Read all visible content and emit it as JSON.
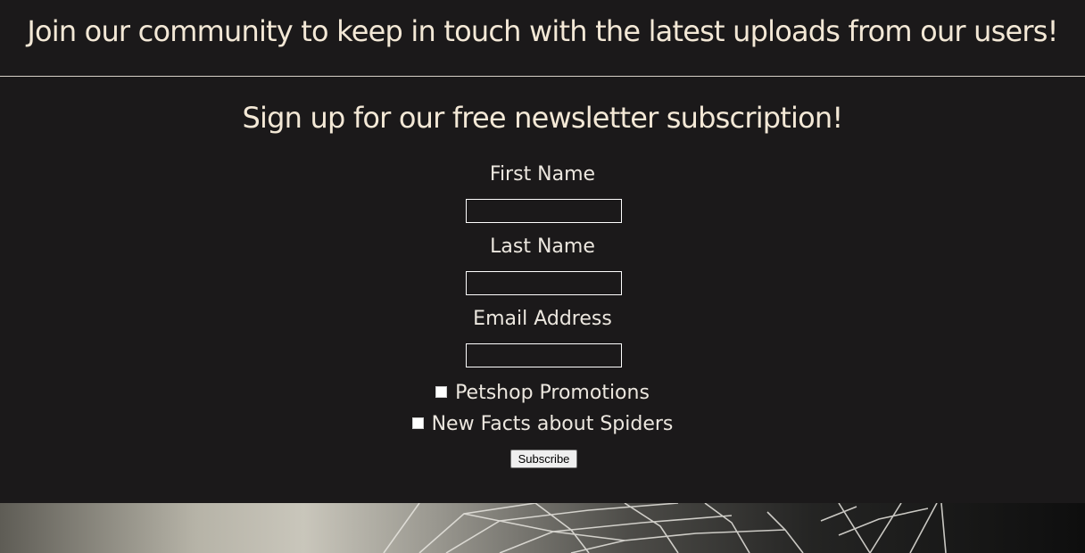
{
  "banner": {
    "heading": "Join our community to keep in touch with the latest uploads from our users!"
  },
  "newsletter": {
    "heading": "Sign up for our free newsletter subscription!",
    "fields": [
      {
        "label": "First Name",
        "value": ""
      },
      {
        "label": "Last Name",
        "value": ""
      },
      {
        "label": "Email Address",
        "value": ""
      }
    ],
    "checkboxes": [
      {
        "label": "Petshop Promotions",
        "checked": false
      },
      {
        "label": "New Facts about Spiders",
        "checked": false
      }
    ],
    "submit_label": "Subscribe"
  },
  "hero": {
    "image": "spider-web-photo"
  },
  "colors": {
    "background": "#1b191a",
    "heading_text": "#f3e8d6",
    "label_text": "#ece7df"
  }
}
